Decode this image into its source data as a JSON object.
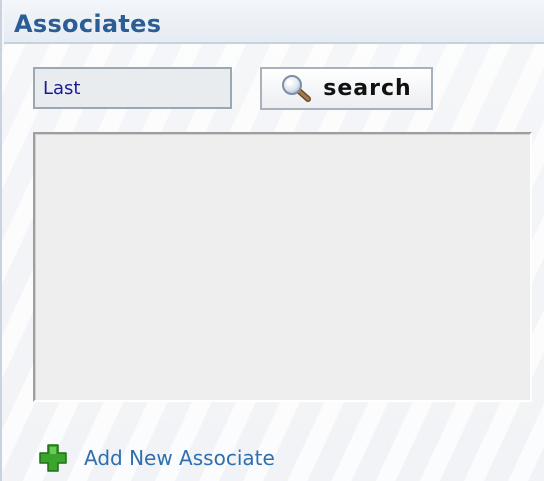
{
  "panel": {
    "title": "Associates"
  },
  "search": {
    "value": "Last",
    "button_label": "search",
    "icon": "magnifier-icon"
  },
  "results": {
    "items": []
  },
  "actions": {
    "add_label": "Add New Associate",
    "add_icon": "green-plus-icon"
  },
  "colors": {
    "title": "#2c5d95",
    "link": "#2f6fb0",
    "plus": "#3aa52a"
  }
}
